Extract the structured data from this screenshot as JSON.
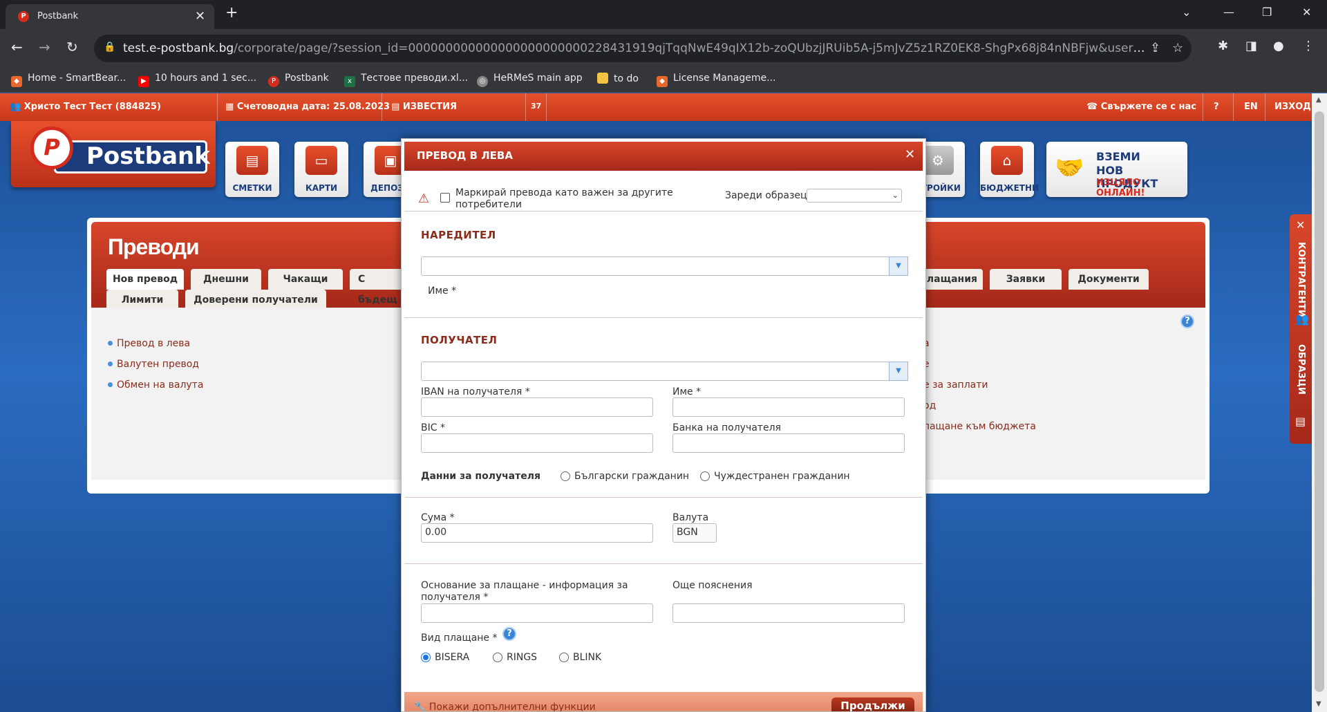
{
  "browser": {
    "tab_title": "Postbank",
    "url_host": "test.e-postbank.bg",
    "url_path": "/corporate/page/?session_id=000000000000000000000000228431919qjTqqNwE49qIX12b-zoQUbzjJRUib5A-j5mJvZ5z1RZ0EK8-ShgPx68j84nNBFjw&user_id=fa23dec6f81b4...",
    "bookmarks": [
      "Home - SmartBear...",
      "10 hours and 1 sec...",
      "Postbank",
      "Тестове преводи.xl...",
      "HeRMeS main app",
      "to do",
      "License Manageme..."
    ]
  },
  "topbar": {
    "user": "Христо Тест Тест (884825)",
    "date": "Счетоводна дата: 25.08.2023",
    "news": "ИЗВЕСТИЯ",
    "count": "37",
    "contact": "Свържете се с нас",
    "lang": "EN",
    "logout": "ИЗХОД"
  },
  "logo": {
    "letter": "P",
    "text": "Postbank"
  },
  "tiles": {
    "accounts": "СМЕТКИ",
    "cards": "КАРТИ",
    "deposits": "ДЕПОЗИ",
    "settings": "СТРОЙКИ",
    "budgets": "БЮДЖЕТНИ"
  },
  "promo": {
    "line1": "ВЗЕМИ",
    "line2": "НОВ ПРОДУКТ",
    "line3": "ИЗЦЯЛО ОНЛАЙН!"
  },
  "panel": {
    "title": "Преводи",
    "tabs_row1": [
      "Нов превод",
      "Днешни",
      "Чакащи",
      "С бъдещ"
    ],
    "tabs_row1_right": [
      "лащания",
      "Заявки",
      "Документи"
    ],
    "tabs_row2": [
      "Лимити",
      "Доверени получатели"
    ],
    "left_links": [
      "Превод в лева",
      "Валутен превод",
      "Обмен на валута"
    ],
    "right_links": [
      "а",
      "е",
      "е за заплати",
      "од",
      "лащане към бюджета"
    ]
  },
  "sidebar": {
    "contacts": "КОНТРАГЕНТИ",
    "templates": "ОБРАЗЦИ"
  },
  "modal": {
    "title": "ПРЕВОД В ЛЕВА",
    "mark_important": "Маркирай превода като важен за другите потребители",
    "load_template": "Зареди образец",
    "payer_section": "НАРЕДИТЕЛ",
    "payer_name_label": "Име *",
    "recipient_section": "ПОЛУЧАТЕЛ",
    "iban_label": "IBAN на получателя *",
    "name_label": "Име *",
    "bic_label": "BIC *",
    "bank_label": "Банка на получателя",
    "recipient_data_label": "Данни за получателя",
    "bulgarian_citizen": "Български гражданин",
    "foreign_citizen": "Чуждестранен гражданин",
    "amount_label": "Сума *",
    "amount_value": "0.00",
    "currency_label": "Валута",
    "currency_value": "BGN",
    "reason_label_1": "Основание за плащане - информация за",
    "reason_label_2": "получателя *",
    "extra_label": "Още пояснения",
    "payment_type_label": "Вид плащане *",
    "payment_types": [
      "BISERA",
      "RINGS",
      "BLINK"
    ],
    "selected_payment_type": "BISERA",
    "more_functions": "Покажи допълнителни функции",
    "continue": "Продължи"
  }
}
